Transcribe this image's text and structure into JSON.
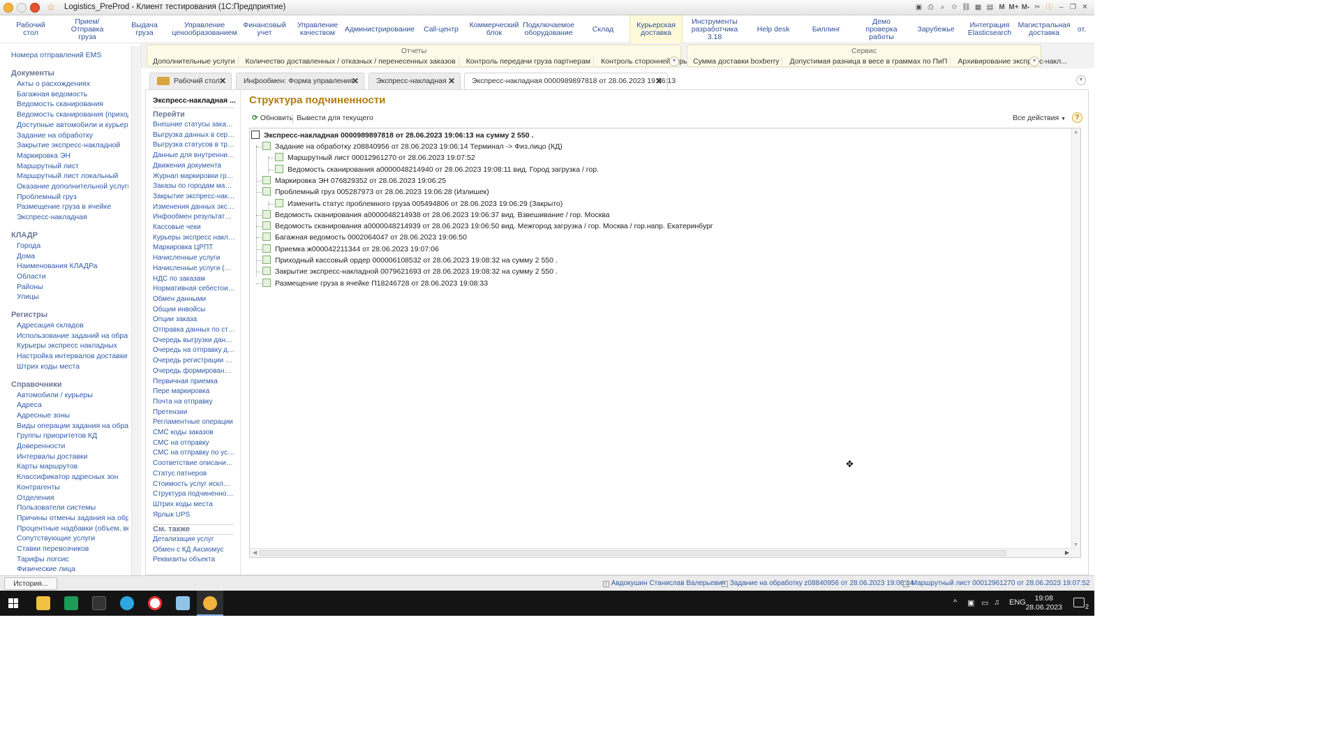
{
  "window": {
    "title": "Logistics_PreProd - Клиент тестирования (1С:Предприятие)",
    "tools": [
      "M",
      "M+",
      "M-"
    ]
  },
  "sections": [
    {
      "label": "Рабочий\nстол"
    },
    {
      "label": "Прием/Отправка\nгруза"
    },
    {
      "label": "Выдача\nгруза"
    },
    {
      "label": "Управление\nценообразованием"
    },
    {
      "label": "Финансовый\nучет"
    },
    {
      "label": "Управление\nкачеством"
    },
    {
      "label": "Администрирование"
    },
    {
      "label": "Call-центр"
    },
    {
      "label": "Коммерческий\nблок"
    },
    {
      "label": "Подключаемое\nоборудование"
    },
    {
      "label": "Склад"
    },
    {
      "label": "Курьерская\nдоставка"
    },
    {
      "label": "Инструменты\nразработчика 3.18"
    },
    {
      "label": "Help desk"
    },
    {
      "label": "Биллинг"
    },
    {
      "label": "Демо проверка\nработы"
    },
    {
      "label": "Зарубежье"
    },
    {
      "label": "Интеграция\nElasticsearch"
    },
    {
      "label": "Магистральная\nдоставка"
    },
    {
      "label": "от."
    }
  ],
  "commands": {
    "reports": {
      "title": "Отчеты",
      "items": [
        "Дополнительные услуги",
        "Количество доставленных / отказных / перенесенных заказов",
        "Контроль передачи груза партнерам",
        "Контроль сторонней курьерской до..."
      ]
    },
    "service": {
      "title": "Сервис",
      "items": [
        "Сумма доставки boxberry",
        "Допустимая разница в весе в граммах по ПиП",
        "Архивирование экспресс-накл..."
      ]
    }
  },
  "left_panel": {
    "top_link": "Номера отправлений EMS",
    "groups": [
      {
        "title": "Документы",
        "items": [
          "Акты о расхождениях",
          "Багажная ведомость",
          "Ведомость сканирования",
          "Ведомость сканирования (приход...",
          "Доступные автомобили и курьеры",
          "Задание на обработку",
          "Закрытие экспресс-накладной",
          "Маркировка ЭН",
          "Маршрутный лист",
          "Маршрутный лист локальный",
          "Оказание дополнительной услуги",
          "Проблемный груз",
          "Размещение груза в ячейке",
          "Экспресс-накладная"
        ]
      },
      {
        "title": "КЛАДР",
        "items": [
          "Города",
          "Дома",
          "Наименования КЛАДРа",
          "Области",
          "Районы",
          "Улицы"
        ]
      },
      {
        "title": "Регистры",
        "items": [
          "Адресация складов",
          "Использование заданий на обрабо...",
          "Курьеры экспресс накладных",
          "Настройка интервалов доставки (А...",
          "Штрих коды места"
        ]
      },
      {
        "title": "Справочники",
        "items": [
          "Автомобили / курьеры",
          "Адреса",
          "Адресные зоны",
          "Виды операции задания на обрабо...",
          "Группы приоритетов КД",
          "Доверенности",
          "Интервалы доставки",
          "Карты маршрутов",
          "Классификатор адресных зон",
          "Контрагенты",
          "Отделения",
          "Пользователи системы",
          "Причины отмены задания на обраб...",
          "Процентные надбавки (объем, вес)",
          "Сопутствующие услуги",
          "Ставки перевозчиков",
          "Тарифы логсис",
          "Физические лица"
        ]
      }
    ]
  },
  "tabs": [
    {
      "label": "Рабочий стол"
    },
    {
      "label": "Инфообмен: Форма управления"
    },
    {
      "label": "Экспресс-накладная"
    },
    {
      "label": "Экспресс-накладная 0000989897818 от 28.06.2023 19:06:13"
    }
  ],
  "nav_panel": {
    "doc_title": "Экспресс-накладная ...",
    "goto_title": "Перейти",
    "goto_items": [
      "Внешние статусы заказов",
      "Выгрузка данных в серви...",
      "Выгрузка статусов в трек...",
      "Данные для внутренних в...",
      "Движения документа",
      "Журнал маркировки груза",
      "Заказы по городам марш...",
      "Закрытие экспресс-накл...",
      "Изменения данных экспр...",
      "Инфообмен результаты з...",
      "Кассовые чеки",
      "Курьеры экспресс накла...",
      "Маркировка ЦРПТ",
      "Начисленные услуги",
      "Начисленные услуги (для ...",
      "НДС по заказам",
      "Нормативная себестоимо...",
      "Обмен данными",
      "Общии инвойсы",
      "Опции заказа",
      "Отправка данных по стат...",
      "Очередь выгрузки данны...",
      "Очередь на отправку дан...",
      "Очередь регистрации отп...",
      "Очередь формирования р...",
      "Первичная приемка",
      "Пере маркировка",
      "Почта на отправку",
      "Претензии",
      "Регламентные операции",
      "СМС коды заказов",
      "СМС на отправку",
      "СМС на отправку по усло...",
      "Соответствие описанию в...",
      "Статус патнеров",
      "Стоимость услуг исключе...",
      "Структура подчиненности",
      "Штрих коды места",
      "Ярлык UPS"
    ],
    "see_also_title": "См. также",
    "see_also_items": [
      "Детализация услуг",
      "Обмен с КД Аксиомус",
      "Реквизиты объекта"
    ]
  },
  "form": {
    "title": "Структура подчиненности",
    "refresh": "Обновить",
    "show_current": "Вывести для текущего",
    "all_actions": "Все действия",
    "help": "?"
  },
  "tree": {
    "root": "Экспресс-накладная 0000989897818 от 28.06.2023 19:06:13 на сумму 2 550 .",
    "nodes": [
      {
        "level": 1,
        "text": "Задание на обработку z08840956 от 28.06.2023 19:06:14  Терминал -> Физ.лицо (КД)"
      },
      {
        "level": 2,
        "text": "Маршрутный лист 00012961270 от 28.06.2023 19:07:52"
      },
      {
        "level": 2,
        "text": "Ведомость сканирования а0000048214940 от 28.06.2023 19:08:11  вид. Город загрузка / гор."
      },
      {
        "level": 1,
        "text": "Маркировка ЭН 076829352 от 28.06.2023 19:06:25"
      },
      {
        "level": 1,
        "text": "Проблемный груз 005287973 от 28.06.2023 19:06:28  (Излишек)"
      },
      {
        "level": 2,
        "text": "Изменить статус проблемного груза 005494806 от 28.06.2023 19:06:29  (Закрыто)"
      },
      {
        "level": 1,
        "text": "Ведомость сканирования а0000048214938 от 28.06.2023 19:06:37  вид. Взвешивание / гор. Москва"
      },
      {
        "level": 1,
        "text": "Ведомость сканирования а0000048214939 от 28.06.2023 19:06:50  вид. Межгород загрузка / гор. Москва / гор.напр. Екатеринбург"
      },
      {
        "level": 1,
        "text": "Багажная ведомость 0002064047 от 28.06.2023 19:06:50"
      },
      {
        "level": 1,
        "text": "Приемка ж000042211344 от 28.06.2023 19:07:06"
      },
      {
        "level": 1,
        "text": "Приходный кассовый ордер 000006108532 от 28.06.2023 19:08:32 на сумму 2 550 ."
      },
      {
        "level": 1,
        "text": "Закрытие экспресс-накладной 0079621693 от 28.06.2023 19:08:32 на сумму 2 550 ."
      },
      {
        "level": 1,
        "text": "Размещение груза в ячейке П18246728 от 28.06.2023 19:08:33"
      }
    ]
  },
  "status_bar": {
    "history": "История...",
    "items": [
      "Авдокушин Станислав Валерьевич",
      "Задание на обработку z08840956 от 28.06.2023 19:06:14",
      "Маршрутный лист 00012961270 от 28.06.2023 19:07:52"
    ]
  },
  "taskbar": {
    "lang": "ENG",
    "time": "19:08",
    "date": "28.06.2023",
    "notif_count": "2"
  }
}
